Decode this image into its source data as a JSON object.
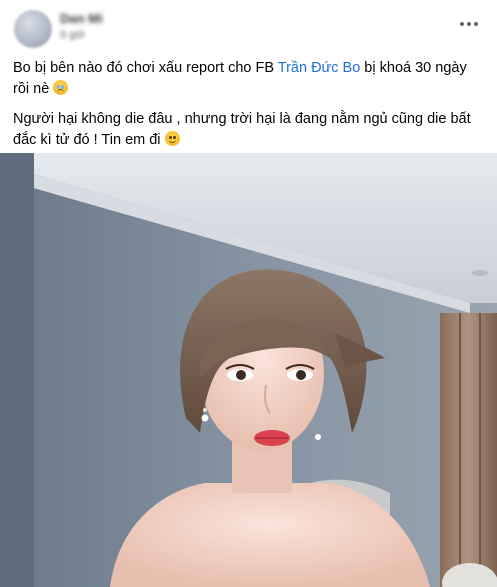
{
  "post": {
    "author_name": "Dan Mi",
    "timestamp": "9 giờ",
    "line1_before_link": "Bo bị bên nào đó chơi xấu report cho FB ",
    "line1_link": "Trần Đức Bo",
    "line1_after_link": " bị khoá 30 ngày rồi nè ",
    "line2": "Người hại không die đâu , nhưng trời hại là đang nằm ngủ cũng die bất đắc kì tử đó ! Tin em đi ",
    "emoji1": "crying-face-icon",
    "emoji2": "smiling-face-icon"
  },
  "colors": {
    "link": "#216fdb",
    "wall": "#7e8a9a",
    "lip": "#d9434f"
  }
}
